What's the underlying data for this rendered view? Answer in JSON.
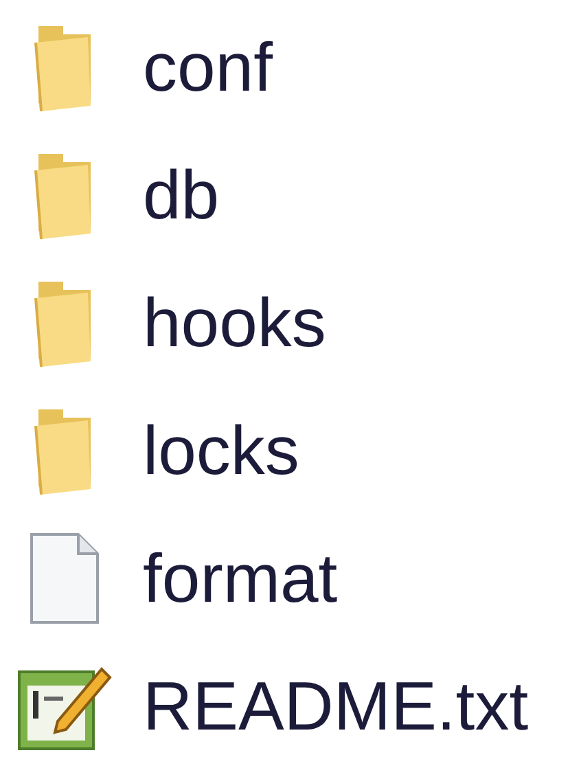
{
  "files": [
    {
      "name": "conf",
      "kind": "folder"
    },
    {
      "name": "db",
      "kind": "folder"
    },
    {
      "name": "hooks",
      "kind": "folder"
    },
    {
      "name": "locks",
      "kind": "folder"
    },
    {
      "name": "format",
      "kind": "file"
    },
    {
      "name": "README.txt",
      "kind": "text"
    }
  ]
}
